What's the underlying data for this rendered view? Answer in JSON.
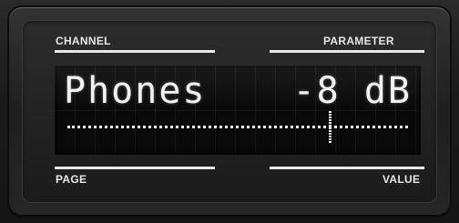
{
  "labels": {
    "channel": "CHANNEL",
    "parameter": "PARAMETER",
    "page": "PAGE",
    "value": "VALUE"
  },
  "display": {
    "channel_name": "Phones",
    "parameter_value": "-8 dB"
  },
  "slider": {
    "level_fraction": 0.77
  },
  "colors": {
    "label_text": "#e6e6e6",
    "lcd_background": "#0a0a0a",
    "lcd_text": "#f2f2f2"
  }
}
